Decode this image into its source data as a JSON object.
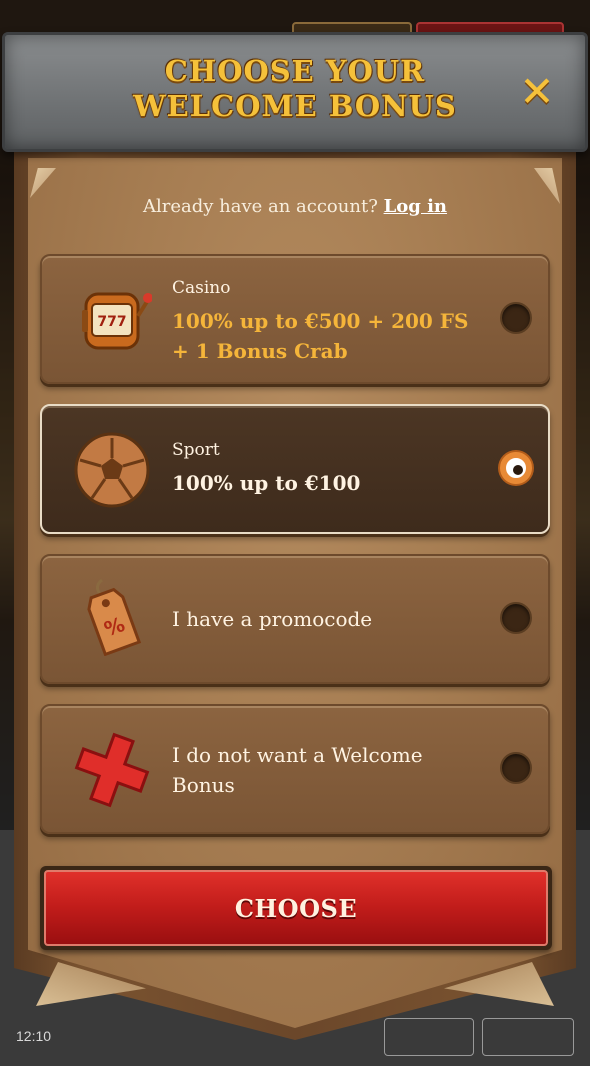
{
  "modal": {
    "title_line1": "CHOOSE YOUR",
    "title_line2": "WELCOME BONUS",
    "close_symbol": "✕",
    "login_prompt": "Already have an account?",
    "login_link": "Log in"
  },
  "options": [
    {
      "label": "Casino",
      "offer": "100% up to €500 + 200 FS + 1 Bonus Crab",
      "icon": "slot-machine-icon",
      "selected": false
    },
    {
      "label": "Sport",
      "offer": "100% up to €100",
      "icon": "soccer-ball-icon",
      "selected": true
    },
    {
      "label": "I have a promocode",
      "icon": "price-tag-icon",
      "selected": false
    },
    {
      "label": "I do not want a Welcome Bonus",
      "icon": "red-cross-icon",
      "selected": false
    }
  ],
  "choose_button": "CHOOSE",
  "status_bar": {
    "time": "12:10"
  },
  "colors": {
    "accent_gold": "#f5c13a",
    "button_red": "#c01c1a",
    "radio_selected": "#e88a36"
  }
}
